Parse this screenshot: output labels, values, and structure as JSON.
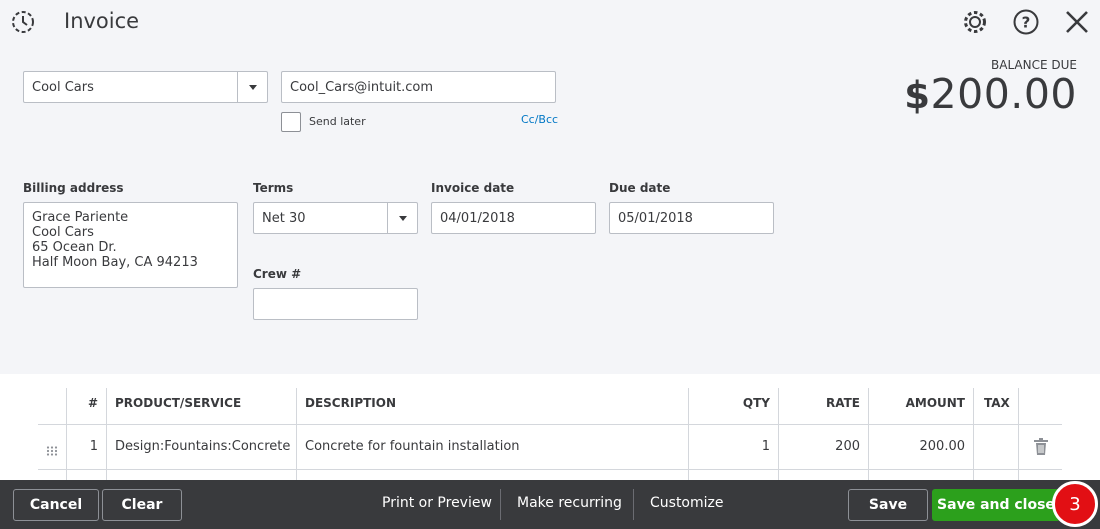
{
  "header": {
    "title": "Invoice",
    "icons": [
      "history-icon",
      "gear-icon",
      "help-icon",
      "close-icon"
    ]
  },
  "customer": {
    "value": "Cool Cars"
  },
  "email": {
    "value": "Cool_Cars@intuit.com"
  },
  "send_later": {
    "label": "Send later",
    "checked": false
  },
  "cc_bcc": "Cc/Bcc",
  "balance": {
    "label": "BALANCE DUE",
    "currency": "$",
    "amount": "200.00"
  },
  "billing": {
    "label": "Billing address",
    "lines": [
      "Grace Pariente",
      "Cool Cars",
      "65 Ocean Dr.",
      "Half Moon Bay, CA  94213"
    ]
  },
  "terms": {
    "label": "Terms",
    "value": "Net 30"
  },
  "invoice_date": {
    "label": "Invoice date",
    "value": "04/01/2018"
  },
  "due_date": {
    "label": "Due date",
    "value": "05/01/2018"
  },
  "crew": {
    "label": "Crew #",
    "value": ""
  },
  "table": {
    "headers": {
      "num": "#",
      "product": "PRODUCT/SERVICE",
      "description": "DESCRIPTION",
      "qty": "QTY",
      "rate": "RATE",
      "amount": "AMOUNT",
      "tax": "TAX"
    },
    "rows": [
      {
        "num": "1",
        "product": "Design:Fountains:Concrete",
        "description": "Concrete for fountain installation",
        "qty": "1",
        "rate": "200",
        "amount": "200.00",
        "tax": ""
      }
    ]
  },
  "footer": {
    "cancel": "Cancel",
    "clear": "Clear",
    "print_preview": "Print or Preview",
    "make_recurring": "Make recurring",
    "customize": "Customize",
    "save": "Save",
    "save_close": "Save and close",
    "badge": "3"
  },
  "colors": {
    "accent_green": "#2ca01c",
    "link_blue": "#0077c5",
    "badge_red": "#e20f14",
    "footer_bg": "#393a3d"
  }
}
